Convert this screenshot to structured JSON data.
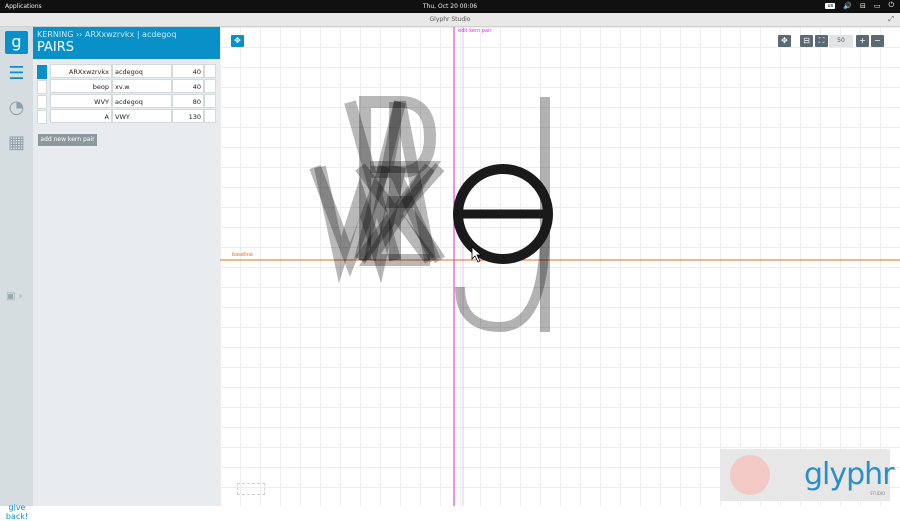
{
  "system_bar": {
    "apps_menu": "Applications",
    "clock": "Thu, Oct 20   00:06",
    "keyboard_layout": "us"
  },
  "window": {
    "title": "Glyphr Studio"
  },
  "panel": {
    "breadcrumb": {
      "section": "KERNING",
      "separator": "››",
      "current": "ARXxwzrvkx | acdegoq"
    },
    "title": "PAIRS",
    "pairs": [
      {
        "left": "ARXxwzrvkx",
        "right": "acdegoq",
        "value": "40",
        "selected": true
      },
      {
        "left": "beop",
        "right": "xv.w",
        "value": "40",
        "selected": false
      },
      {
        "left": "WVY",
        "right": "acdegoq",
        "value": "80",
        "selected": false
      },
      {
        "left": "A",
        "right": "VWY",
        "value": "130",
        "selected": false
      }
    ],
    "add_button": "add new kern pair"
  },
  "rail": {
    "give_back": "give back!"
  },
  "canvas": {
    "zoom_value": "50",
    "baseline_label": "baseline",
    "edit_line_label": "edit kern pair",
    "left_group_letters": "ARXxwzrvkx",
    "right_group_letters": "acdegoq"
  },
  "splash": {
    "brand": "glyphr",
    "tagline": "STUDIO"
  },
  "colors": {
    "accent": "#0a90c8",
    "baseline": "#e46b1f",
    "kern_line": "#e226d8"
  }
}
